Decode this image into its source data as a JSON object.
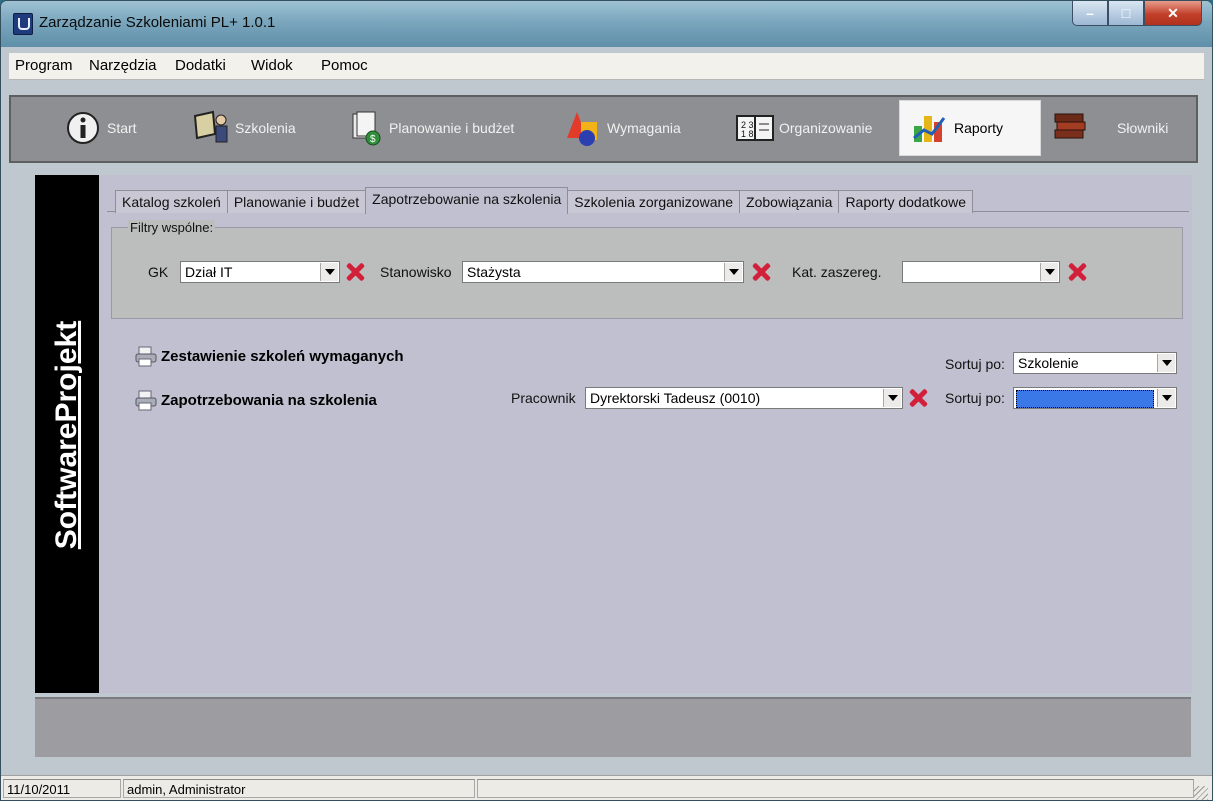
{
  "window": {
    "title": "Zarządzanie Szkoleniami PL+ 1.0.1",
    "controls": {
      "minimize": "–",
      "maximize": "□",
      "close": "✕"
    }
  },
  "menu": {
    "items": [
      "Program",
      "Narzędzia",
      "Dodatki",
      "Widok",
      "Pomoc"
    ]
  },
  "toolbar": {
    "items": [
      {
        "label": "Start",
        "icon": "info-icon"
      },
      {
        "label": "Szkolenia",
        "icon": "trainers-icon"
      },
      {
        "label": "Planowanie i budżet",
        "icon": "budget-icon"
      },
      {
        "label": "Wymagania",
        "icon": "shapes-icon"
      },
      {
        "label": "Organizowanie",
        "icon": "calendar-icon"
      },
      {
        "label": "Raporty",
        "icon": "reports-icon",
        "active": true
      },
      {
        "label": "Słowniki",
        "icon": "books-icon"
      }
    ]
  },
  "brand": {
    "text": "SoftwareProjekt"
  },
  "tabs": [
    {
      "label": "Katalog szkoleń"
    },
    {
      "label": "Planowanie i budżet"
    },
    {
      "label": "Zapotrzebowanie na szkolenia",
      "active": true
    },
    {
      "label": "Szkolenia zorganizowane"
    },
    {
      "label": "Zobowiązania"
    },
    {
      "label": "Raporty dodatkowe"
    }
  ],
  "filters": {
    "legend": "Filtry wspólne:",
    "gk": {
      "label": "GK",
      "value": "Dział IT"
    },
    "stanowisko": {
      "label": "Stanowisko",
      "value": "Stażysta"
    },
    "kat": {
      "label": "Kat. zaszereg.",
      "value": ""
    }
  },
  "reports": {
    "zestawienie": {
      "label": "Zestawienie szkoleń wymaganych",
      "sort_label": "Sortuj po:",
      "sort_value": "Szkolenie"
    },
    "zapotrzebowania": {
      "label": "Zapotrzebowania na szkolenia",
      "employee_label": "Pracownik",
      "employee_value": "Dyrektorski Tadeusz (0010)",
      "sort_label": "Sortuj po:",
      "sort_value": ""
    }
  },
  "status": {
    "date": "11/10/2011",
    "user": "admin, Administrator",
    "extra": ""
  },
  "colors": {
    "brand_bg": "#000000",
    "panel_bg": "#c1c0d0",
    "toolbar_bg": "#8d8f92",
    "delete_x": "#d21f3a",
    "selection": "#3b78e7"
  }
}
